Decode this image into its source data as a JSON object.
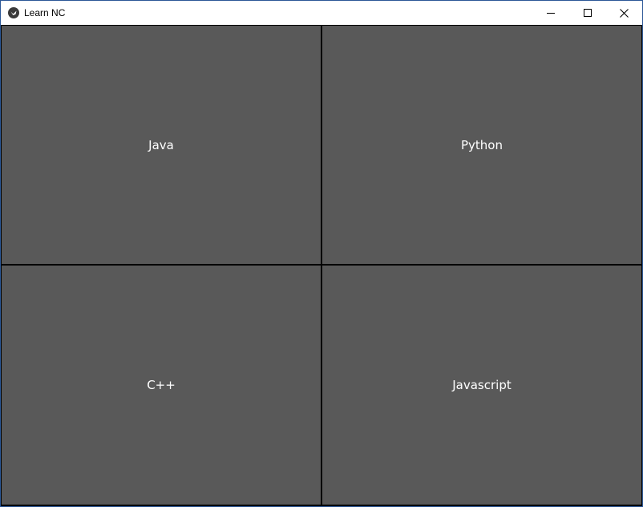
{
  "window": {
    "title": "Learn NC",
    "app_icon": "kivy-logo-icon",
    "controls": {
      "minimize_icon": "minimize-icon",
      "maximize_icon": "maximize-icon",
      "close_icon": "close-icon"
    }
  },
  "grid": {
    "buttons": [
      {
        "label": "Java"
      },
      {
        "label": "Python"
      },
      {
        "label": "C++"
      },
      {
        "label": "Javascript"
      }
    ]
  },
  "colors": {
    "button_background": "#595959",
    "button_text": "#ffffff",
    "content_background": "#000000",
    "titlebar_background": "#ffffff",
    "window_border": "#2b5797"
  }
}
